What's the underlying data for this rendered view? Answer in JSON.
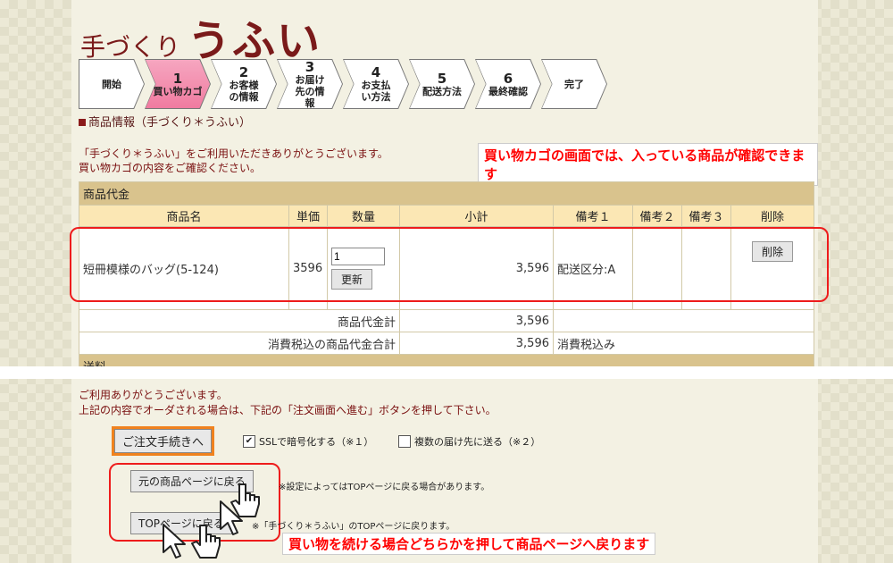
{
  "logo": {
    "small": "手づくり",
    "big": "うふい"
  },
  "steps": [
    {
      "num": "",
      "label": "開始"
    },
    {
      "num": "1",
      "label": "買い物カゴ"
    },
    {
      "num": "2",
      "label": "お客様の情報"
    },
    {
      "num": "3",
      "label": "お届け先の情報"
    },
    {
      "num": "4",
      "label": "お支払い方法"
    },
    {
      "num": "5",
      "label": "配送方法"
    },
    {
      "num": "6",
      "label": "最終確認"
    },
    {
      "num": "",
      "label": "完了"
    }
  ],
  "section_title": "商品情報（手づくり＊うふい）",
  "intro": {
    "line1": "「手づくり＊うふい」をご利用いただきありがとうございます。",
    "line2": "買い物カゴの内容をご確認ください。"
  },
  "callout_top": "買い物カゴの画面では、入っている商品が確認できます",
  "cart": {
    "section_label": "商品代金",
    "columns": [
      "商品名",
      "単価",
      "数量",
      "小計",
      "備考１",
      "備考２",
      "備考３",
      "削除"
    ],
    "item": {
      "name": "短冊模様のバッグ(5-124)",
      "price": "3596",
      "qty": "1",
      "update": "更新",
      "subtotal": "3,596",
      "note1": "配送区分:A",
      "delete": "削除"
    },
    "total_label": "商品代金計",
    "total_value": "3,596",
    "tax_label": "消費税込の商品代金合計",
    "tax_value": "3,596",
    "tax_note": "消費税込み",
    "shipping_label": "送料"
  },
  "bottom": {
    "thanks1": "ご利用ありがとうございます。",
    "thanks2": "上記の内容でオーダされる場合は、下記の「注文画面へ進む」ボタンを押して下さい。",
    "order_button": "ご注文手続きへ",
    "ssl_label": "SSLで暗号化する（※１）",
    "multi_label": "複数の届け先に送る（※２）",
    "back_button": "元の商品ページに戻る",
    "back_note": "※設定によってはTOPページに戻る場合があります。",
    "top_button": "TOPページに戻る",
    "top_note": "※「手づくり＊うふい」のTOPページに戻ります。",
    "callout": "買い物を続ける場合どちらかを押して商品ページへ戻ります"
  },
  "colors": {
    "accent_red": "#ee1c1c",
    "brand": "#7a1a1a",
    "active_step": "#f07ba0",
    "orange": "#f0821e"
  }
}
